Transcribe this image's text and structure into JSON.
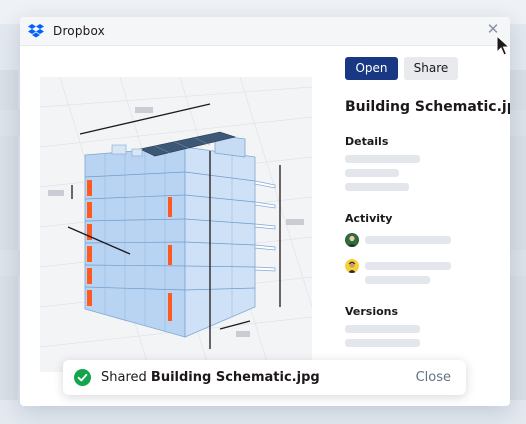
{
  "window": {
    "app_title": "Dropbox",
    "close_icon": "close-icon",
    "logo_icon": "dropbox-logo-icon"
  },
  "toolbar": {
    "open_label": "Open",
    "share_label": "Share"
  },
  "file": {
    "name": "Building Schematic.jpg"
  },
  "sections": {
    "details": "Details",
    "activity": "Activity",
    "versions": "Versions"
  },
  "toast": {
    "prefix": "Shared",
    "filename": "Building Schematic.jpg",
    "close_label": "Close",
    "status_icon": "check-circle-icon"
  },
  "colors": {
    "primary": "#183884",
    "accent_orange": "#ff5a1f",
    "success": "#14a44d"
  }
}
